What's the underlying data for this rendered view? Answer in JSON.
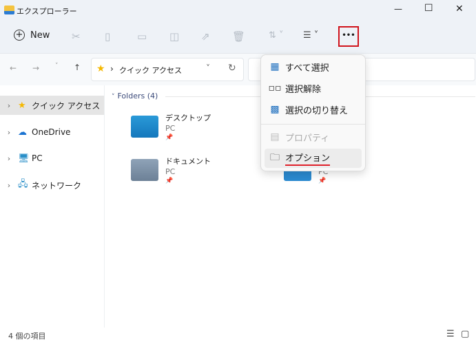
{
  "window": {
    "title": "エクスプローラー",
    "minimize": "—",
    "maximize": "☐",
    "close": "✕"
  },
  "toolbar": {
    "new_label": "New",
    "more_label": "•••",
    "sort_caret": "⇅ ˅",
    "view_caret": "☰ ˅"
  },
  "address": {
    "path": "クイック アクセス",
    "separator": "›"
  },
  "sidebar": {
    "items": [
      {
        "label": "クイック アクセス",
        "icon": "star-icon"
      },
      {
        "label": "OneDrive",
        "icon": "cloud-icon"
      },
      {
        "label": "PC",
        "icon": "monitor-icon"
      },
      {
        "label": "ネットワーク",
        "icon": "network-icon"
      }
    ]
  },
  "content": {
    "group_header": "Folders (4)",
    "folders": [
      {
        "name": "デスクトップ",
        "location": "PC"
      },
      {
        "name": "ドキュメント",
        "location": "PC"
      },
      {
        "name": "",
        "location": "PC"
      }
    ]
  },
  "menu": {
    "items": [
      {
        "label": "すべて選択",
        "enabled": true
      },
      {
        "label": "選択解除",
        "enabled": true
      },
      {
        "label": "選択の切り替え",
        "enabled": true
      },
      {
        "label": "プロパティ",
        "enabled": false
      },
      {
        "label": "オプション",
        "enabled": true,
        "highlighted": true
      }
    ]
  },
  "statusbar": {
    "count": "4 個の項目"
  },
  "colors": {
    "accent": "#1e6fbf",
    "highlight_box": "#d0131b",
    "underline": "#e0202a"
  }
}
